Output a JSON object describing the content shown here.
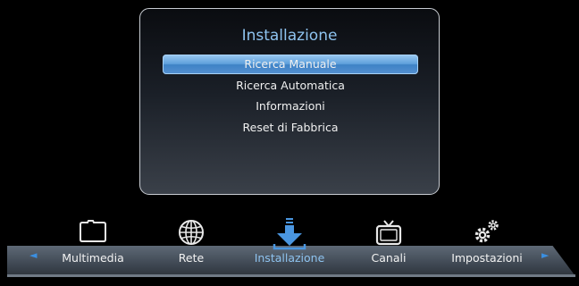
{
  "panel": {
    "title": "Installazione",
    "items": [
      {
        "label": "Ricerca Manuale",
        "selected": true
      },
      {
        "label": "Ricerca Automatica",
        "selected": false
      },
      {
        "label": "Informazioni",
        "selected": false
      },
      {
        "label": "Reset di Fabbrica",
        "selected": false
      }
    ]
  },
  "nav": {
    "left_arrow": "◄",
    "right_arrow": "►",
    "items": [
      {
        "label": "Multimedia",
        "icon": "folder-icon"
      },
      {
        "label": "Rete",
        "icon": "globe-icon"
      },
      {
        "label": "Installazione",
        "icon": "download-icon",
        "active": true
      },
      {
        "label": "Canali",
        "icon": "tv-icon"
      },
      {
        "label": "Impostazioni",
        "icon": "gears-icon"
      }
    ]
  },
  "colors": {
    "accent": "#3b8fe0",
    "title": "#8ec3ef",
    "selection": "#5e9fdb"
  }
}
